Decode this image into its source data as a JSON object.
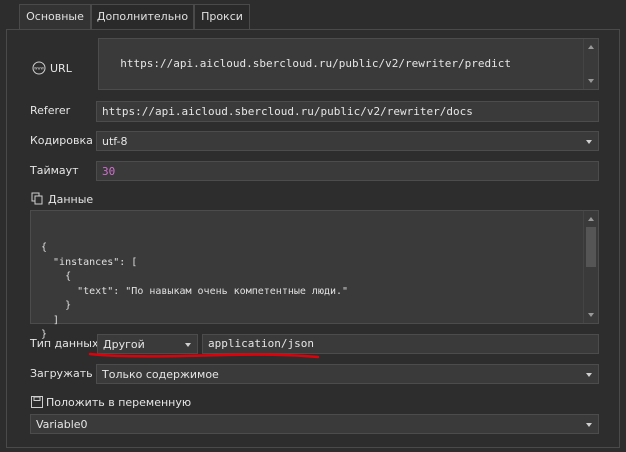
{
  "tabs": [
    {
      "label": "Основные"
    },
    {
      "label": "Дополнительно"
    },
    {
      "label": "Прокси"
    }
  ],
  "url": {
    "label": "URL",
    "icon": "www-icon",
    "value": "https://api.aicloud.sbercloud.ru/public/v2/rewriter/predict"
  },
  "referer": {
    "label": "Referer",
    "value": "https://api.aicloud.sbercloud.ru/public/v2/rewriter/docs"
  },
  "encoding": {
    "label": "Кодировка",
    "value": "utf-8"
  },
  "timeout": {
    "label": "Таймаут",
    "value": "30"
  },
  "data": {
    "label": "Данные",
    "icon": "copy-icon",
    "lines": [
      "{",
      "  \"instances\": [",
      "    {",
      "      \"text\": \"По навыкам очень компетентные люди.\"",
      "    }",
      "  ]",
      "}"
    ]
  },
  "data_type": {
    "label": "Тип данных",
    "value": "Другой",
    "content_type": "application/json"
  },
  "load": {
    "label": "Загружать",
    "value": "Только содержимое"
  },
  "save_var": {
    "label": "Положить в переменную",
    "icon": "save-icon",
    "value": "Variable0"
  },
  "colors": {
    "annotation": "#e0000a",
    "timeout_number": "#d070d0"
  }
}
